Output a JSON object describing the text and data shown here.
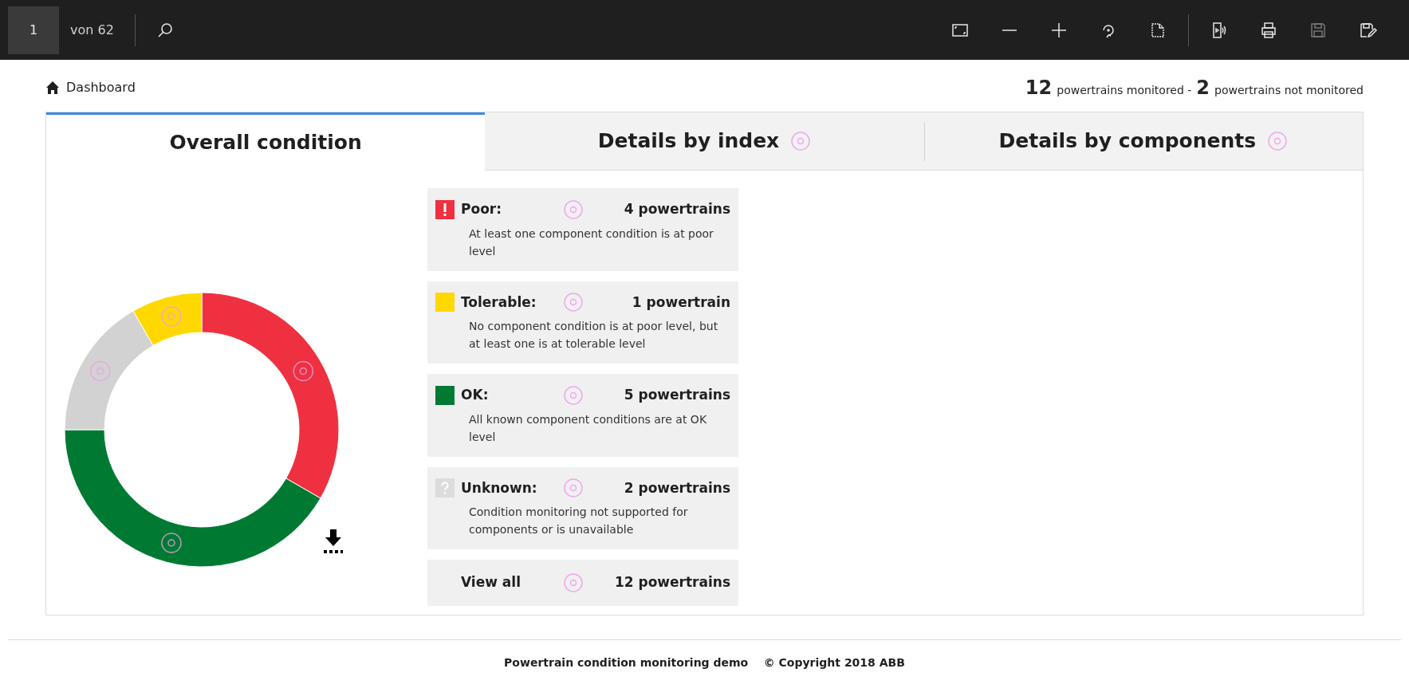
{
  "viewer": {
    "page": "1",
    "page_count": "von 62"
  },
  "breadcrumb": "Dashboard",
  "summary": {
    "monitored_count": "12",
    "monitored_label": "powertrains monitored -",
    "not_monitored_count": "2",
    "not_monitored_label": "powertrains not monitored"
  },
  "tabs": [
    {
      "label": "Overall condition",
      "selected": true,
      "target": false
    },
    {
      "label": "Details by index",
      "selected": false,
      "target": true
    },
    {
      "label": "Details by components",
      "selected": false,
      "target": true
    }
  ],
  "chart": {
    "chart_data": {
      "type": "donut",
      "values": [
        33.33,
        41.67,
        16.67,
        8.33
      ],
      "colors": [
        "#ef3040",
        "#007a33",
        "#d2d2d2",
        "#ffd800"
      ]
    }
  },
  "conditions": [
    {
      "kind": "poor",
      "color": "#ef3040",
      "label": "Poor:",
      "count": "4 powertrains",
      "description": "At least one component condition is at poor level"
    },
    {
      "kind": "tolerable",
      "color": "#ffd800",
      "label": "Tolerable:",
      "count": "1 powertrain",
      "description": "No component condition is at poor level, but at least one is at tolerable level"
    },
    {
      "kind": "ok",
      "color": "#007a33",
      "label": "OK:",
      "count": "5 powertrains",
      "description": "All known component conditions are at OK level"
    },
    {
      "kind": "unknown",
      "color": "#dcdcdc",
      "label": "Unknown:",
      "count": "2 powertrains",
      "description": "Condition monitoring not supported for components or is unavailable"
    },
    {
      "kind": "all",
      "label": "View all",
      "count": "12 powertrains"
    }
  ],
  "footer": "Powertrain condition monitoring demo    © Copyright 2018 ABB"
}
